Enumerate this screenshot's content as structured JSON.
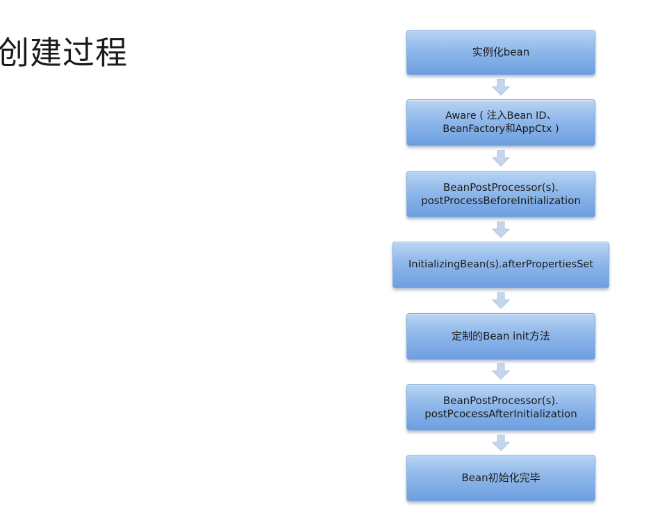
{
  "title": "创建过程",
  "flow": {
    "steps": [
      "实例化bean",
      "Aware ( 注入Bean ID、\nBeanFactory和AppCtx )",
      "BeanPostProcessor(s).\npostProcessBeforeInitialization",
      "InitializingBean(s).afterPropertiesSet",
      "定制的Bean init方法",
      "BeanPostProcessor(s).\npostPcocessAfterInitialization",
      "Bean初始化完毕"
    ],
    "colors": {
      "box_top": "#b9d4f3",
      "box_bottom": "#6d9fe0",
      "arrow": "#c5d6ec"
    }
  }
}
